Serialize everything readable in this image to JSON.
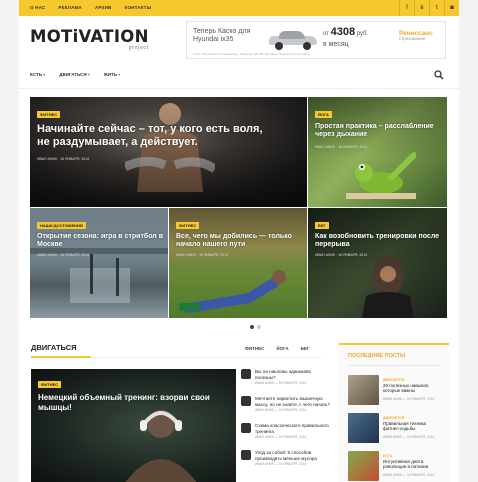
{
  "topbar": {
    "nav": [
      "О НАС",
      "РЕКЛАМА",
      "АРХИВ",
      "КОНТАКТЫ"
    ],
    "social": [
      "facebook-icon",
      "vk-icon",
      "twitter-icon",
      "instagram-icon"
    ]
  },
  "brand": {
    "logo": "MOTiVATION",
    "sub": "project"
  },
  "banner": {
    "line1": "Теперь Каско для",
    "line2": "Hyundai ix35",
    "price_prefix": "от",
    "price": "4308",
    "price_suffix": "руб.",
    "per": "в месяц",
    "company": "Ренессанс",
    "company_sub": "страхование",
    "fine": "ООО «Ренессанс Страхование». Лицензия ЦБ РФ. Реклама. Подробности на сайте."
  },
  "mainnav": [
    "ЕСТЬ",
    "ДВИГАТЬСЯ",
    "ЖИТЬ"
  ],
  "tiles": [
    {
      "tag": "ФИТНЕС",
      "title": "Начинайте сейчас – тот, у кого есть воля, не раздумывает, а действует.",
      "author": "ИВАН АНИК",
      "date": "16 ЯНВАРЯ, 2014"
    },
    {
      "tag": "ЙОГА",
      "title": "Простая практика – расслабление через дыхание",
      "author": "ИВАН АНИК",
      "date": "16 ЯНВАРЯ, 2014"
    },
    {
      "tag": "НАШИ ДОСТИЖЕНИЯ",
      "title": "Открытие сезона: игра в стритбол в Москве",
      "author": "ИВАН АНИК",
      "date": "16 ЯНВАРЯ, 2014"
    },
    {
      "tag": "ФИТНЕС",
      "title": "Все, чего мы добились — только начало нашего пути",
      "author": "ИВАН АНИК",
      "date": "16 ЯНВАРЯ, 2014"
    },
    {
      "tag": "БЕГ",
      "title": "Как возобновить тренировки после перерыва",
      "author": "ИВАН АНИК",
      "date": "16 ЯНВАРЯ, 2014"
    }
  ],
  "section": {
    "title": "ДВИГАТЬСЯ",
    "tabs": [
      "ФИТНЕС",
      "ЙОГА",
      "БЕГ"
    ],
    "featured": {
      "tag": "ФИТНЕС",
      "title": "Немецкий объемный тренинг: взорви свои мышцы!"
    },
    "list": [
      {
        "title": "Вы ли наклоны одинаково полезны?",
        "date": "ИВАН АНИК — 16 ЯНВАРЯ, 2014"
      },
      {
        "title": "Мечтаете нарастить мышечную массу, но не знаете, с чего начать?",
        "date": "ИВАН АНИК — 16 ЯНВАРЯ, 2014"
      },
      {
        "title": "Схема классического правильного тренинга",
        "date": "ИВАН АНИК — 16 ЯНВАРЯ, 2014"
      },
      {
        "title": "Уход за собой: 5 способов производить меньше мусора",
        "date": "ИВАН АНИК — 16 ЯНВАРЯ, 2014"
      }
    ]
  },
  "widget": {
    "title": "ПОСЛЕДНИЕ ПОСТЫ",
    "posts": [
      {
        "cat": "ДВИГАЕТСЯ",
        "title": "20 полезных навыков, которые важны",
        "date": "ИВАН АНИК — 16 ЯНВАРЯ, 2014"
      },
      {
        "cat": "ДВИГАЕТСЯ",
        "title": "Правильная техника фитнес-ходьбы",
        "date": "ИВАН АНИК — 16 ЯНВАРЯ, 2014"
      },
      {
        "cat": "ЕСТЬ",
        "title": "Интуитивная диета: революция в питании",
        "date": "ИВАН АНИК — 16 ЯНВАРЯ, 2014"
      }
    ]
  }
}
